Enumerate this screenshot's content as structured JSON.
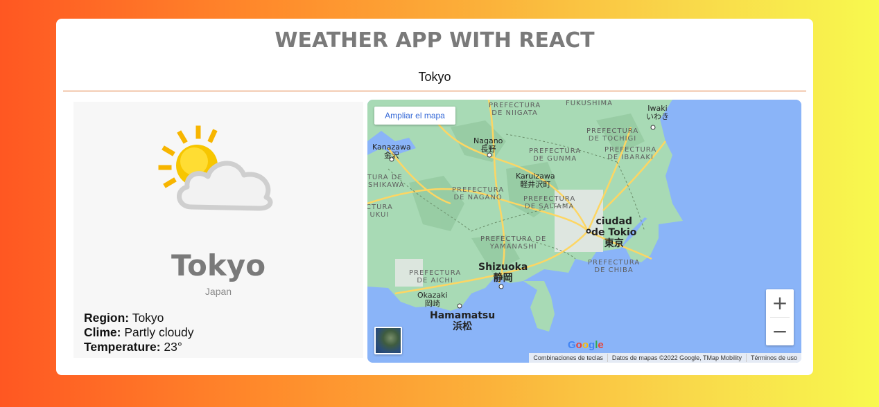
{
  "header": {
    "title": "WEATHER APP WITH REACT"
  },
  "search": {
    "value": "Tokyo"
  },
  "weather": {
    "icon": "partly-cloudy-icon",
    "city": "Tokyo",
    "country": "Japan",
    "region_label": "Region:",
    "region": "Tokyo",
    "clime_label": "Clime:",
    "clime": "Partly cloudy",
    "temperature_label": "Temperature:",
    "temperature": "23°"
  },
  "map": {
    "expand_button": "Ampliar el mapa",
    "zoom_in": "+",
    "zoom_out": "−",
    "google_logo": "Google",
    "attribution": {
      "shortcuts": "Combinaciones de teclas",
      "data": "Datos de mapas ©2022 Google, TMap Mobility",
      "terms": "Términos de uso"
    },
    "labels": {
      "niigata": "PREFECTURA\nDE NIIGATA",
      "fukushima": "FUKUSHIMA",
      "iwaki": "Iwaki\nいわき",
      "tochigi": "PREFECTURA\nDE TOCHIGI",
      "kanazawa": "Kanazawa\n金沢",
      "nagano_city": "Nagano\n長野",
      "gunma": "PREFECTURA\nDE GUNMA",
      "ibaraki": "PREFECTURA\nDE IBARAKI",
      "karuizawa": "Karuizawa\n軽井沢町",
      "ishikawa": "TURA DE\nISHIKAWA",
      "nagano_pref": "PREFECTURA\nDE NAGANO",
      "saitama": "PREFECTURA\nDE SAITAMA",
      "fukui": "CTURA\nUKUI",
      "tokyo": "ciudad\nde Tokio\n東京",
      "yamanashi": "PREFECTURA DE\nYAMANASHI",
      "shizuoka": "Shizuoka\n静岡",
      "aichi": "PREFECTURA\nDE AICHI",
      "chiba": "PREFECTURA\nDE CHIBA",
      "okazaki": "Okazaki\n岡崎",
      "hamamatsu": "Hamamatsu\n浜松"
    },
    "colors": {
      "sea": "#8ab4f8",
      "land": "#a8dab5",
      "road": "#fdd663"
    }
  }
}
